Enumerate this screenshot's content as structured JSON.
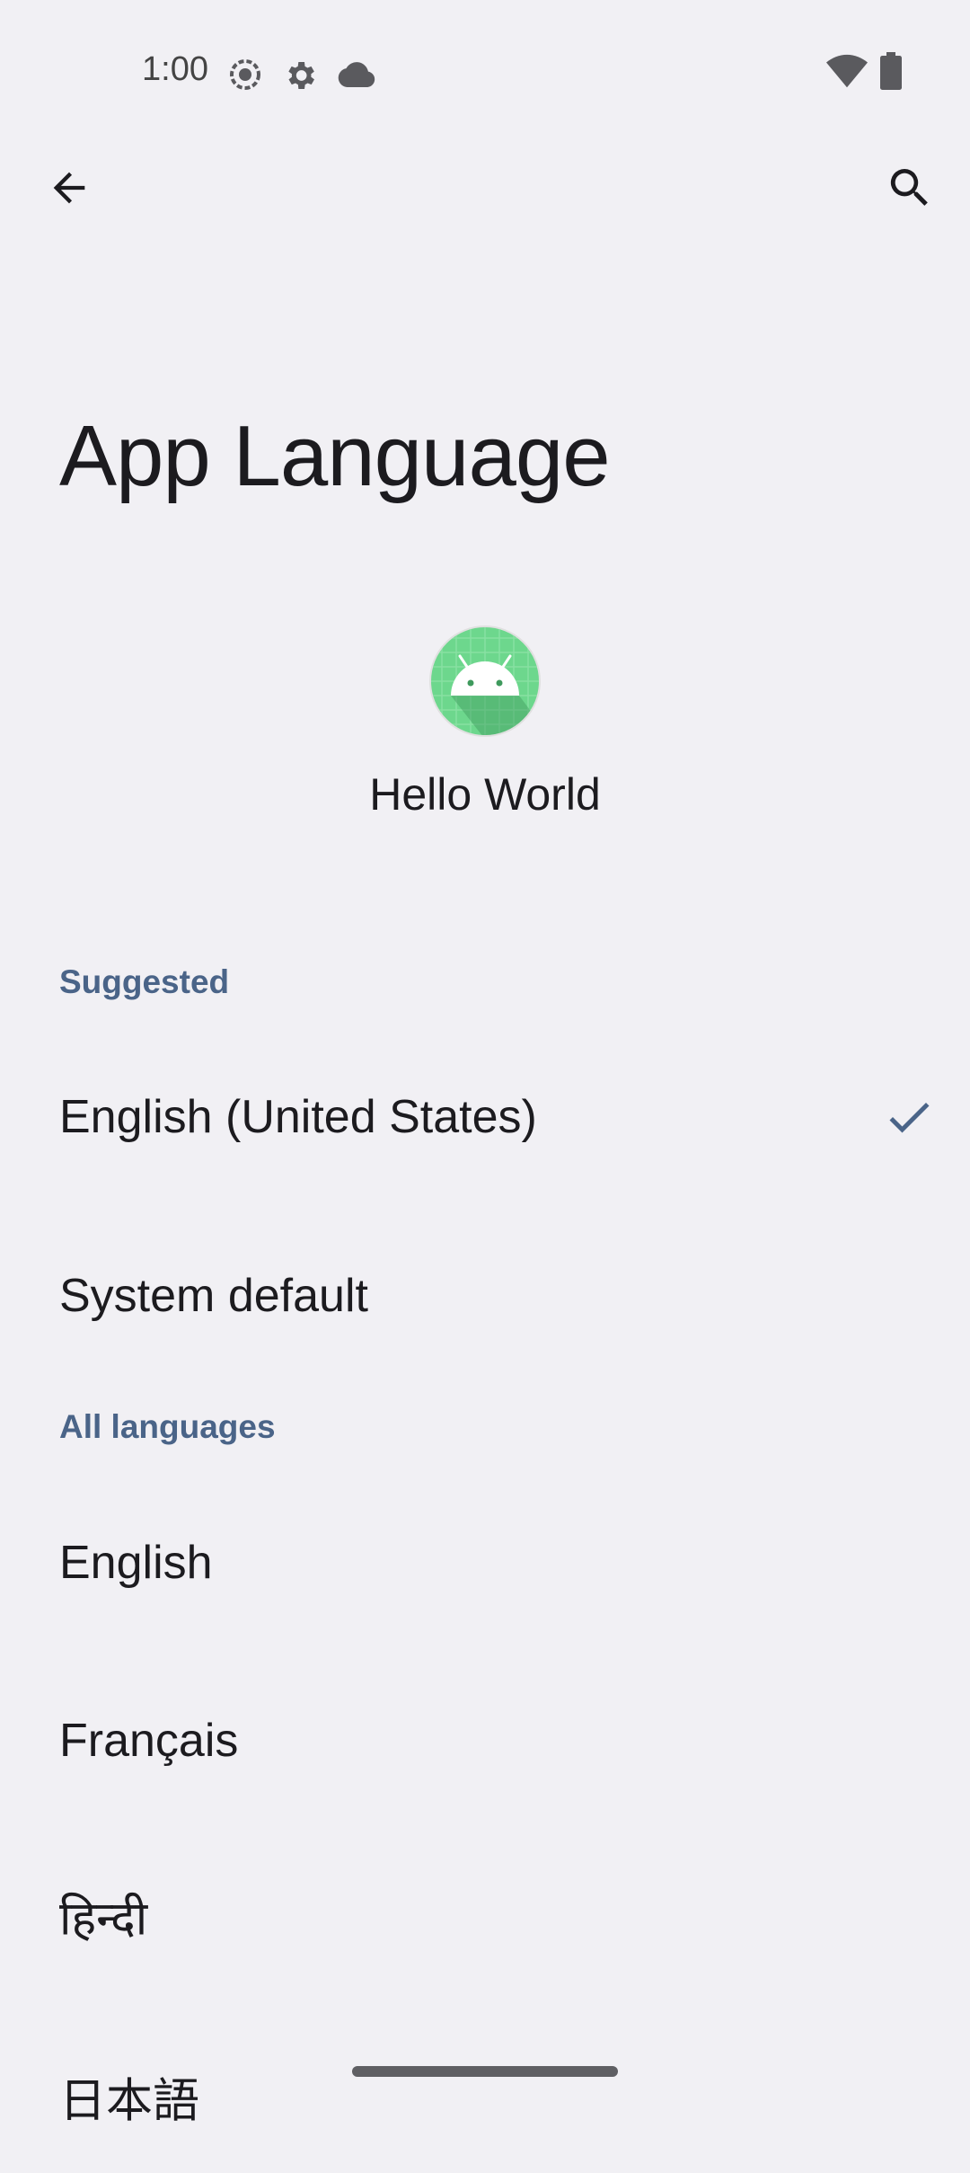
{
  "status_bar": {
    "time": "1:00",
    "left_icons": [
      "screen-record-icon",
      "settings-gear-icon",
      "cloud-icon"
    ],
    "right_icons": [
      "wifi-icon",
      "battery-icon"
    ]
  },
  "app_bar": {
    "back_icon": "arrow-back-icon",
    "search_icon": "search-icon"
  },
  "page": {
    "title": "App Language"
  },
  "app": {
    "name": "Hello World",
    "icon": "android-icon",
    "icon_color": "#6dd78d"
  },
  "sections": {
    "suggested": {
      "header": "Suggested",
      "items": [
        {
          "label": "English (United States)",
          "selected": true
        },
        {
          "label": "System default",
          "selected": false
        }
      ]
    },
    "all_languages": {
      "header": "All languages",
      "items": [
        {
          "label": "English"
        },
        {
          "label": "Français"
        },
        {
          "label": "हिन्दी"
        },
        {
          "label": "日本語"
        }
      ]
    }
  },
  "colors": {
    "background": "#f1f0f4",
    "accent": "#4a6488",
    "text_primary": "#1c1b1f"
  }
}
